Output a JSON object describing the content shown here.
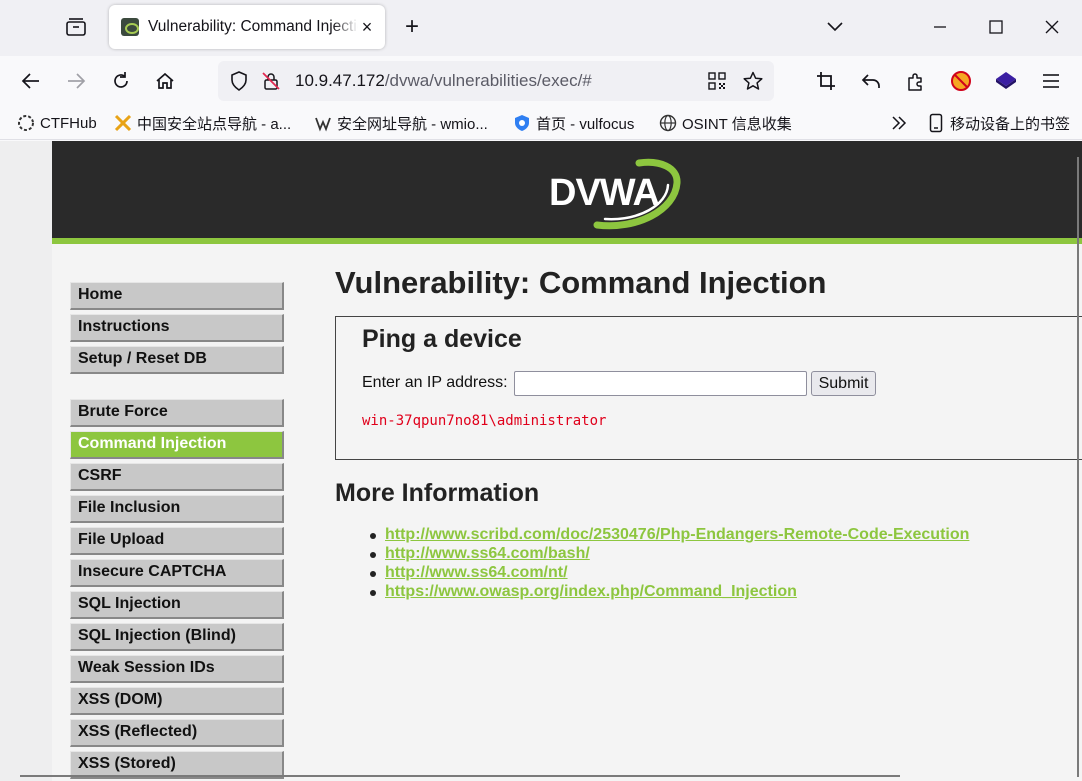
{
  "browser": {
    "tab_title": "Vulnerability: Command Injection",
    "tab_close": "×",
    "new_tab": "+",
    "url_host": "10.9.47.172",
    "url_path": "/dvwa/vulnerabilities/exec/#",
    "bookmarks": [
      {
        "label": "CTFHub",
        "icon": "ctfhub-icon"
      },
      {
        "label": "中国安全站点导航 - a...",
        "icon": "crossed-swords-icon"
      },
      {
        "label": "安全网址导航 - wmio...",
        "icon": "wmio-icon"
      },
      {
        "label": "首页 - vulfocus",
        "icon": "vulfocus-shield-icon"
      },
      {
        "label": "OSINT 信息收集",
        "icon": "globe-icon"
      }
    ],
    "mobile_bookmarks": "移动设备上的书签"
  },
  "page": {
    "logo": "DVWA",
    "menu": [
      {
        "label": "Home",
        "active": false
      },
      {
        "label": "Instructions",
        "active": false
      },
      {
        "label": "Setup / Reset DB",
        "active": false
      },
      {
        "label": "Brute Force",
        "active": false
      },
      {
        "label": "Command Injection",
        "active": true
      },
      {
        "label": "CSRF",
        "active": false
      },
      {
        "label": "File Inclusion",
        "active": false
      },
      {
        "label": "File Upload",
        "active": false
      },
      {
        "label": "Insecure CAPTCHA",
        "active": false
      },
      {
        "label": "SQL Injection",
        "active": false
      },
      {
        "label": "SQL Injection (Blind)",
        "active": false
      },
      {
        "label": "Weak Session IDs",
        "active": false
      },
      {
        "label": "XSS (DOM)",
        "active": false
      },
      {
        "label": "XSS (Reflected)",
        "active": false
      },
      {
        "label": "XSS (Stored)",
        "active": false
      }
    ],
    "title": "Vulnerability: Command Injection",
    "form_title": "Ping a device",
    "ip_label": "Enter an IP address:",
    "ip_value": "",
    "submit_label": "Submit",
    "output": "win-37qpun7no81\\administrator",
    "more_info_title": "More Information",
    "links": [
      "http://www.scribd.com/doc/2530476/Php-Endangers-Remote-Code-Execution",
      "http://www.ss64.com/bash/",
      "http://www.ss64.com/nt/",
      "https://www.owasp.org/index.php/Command_Injection"
    ]
  },
  "colors": {
    "accent_green": "#8dc63f",
    "header_dark": "#2a2a2a",
    "output_red": "#e0001b"
  }
}
